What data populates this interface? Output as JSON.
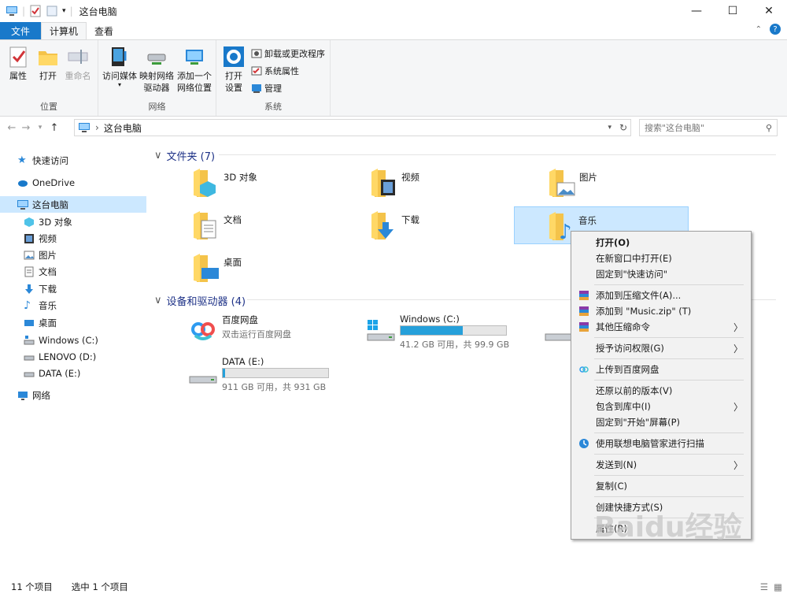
{
  "window": {
    "title": "这台电脑",
    "min": "—",
    "max": "☐",
    "close": "✕"
  },
  "tabs": {
    "file": "文件",
    "computer": "计算机",
    "view": "查看",
    "help": "?"
  },
  "ribbon": {
    "location": {
      "label": "位置",
      "properties": "属性",
      "open": "打开",
      "rename": "重命名"
    },
    "network": {
      "label": "网络",
      "media1": "访问媒体",
      "map1": "映射网络",
      "map2": "驱动器",
      "add1": "添加一个",
      "add2": "网络位置"
    },
    "system": {
      "label": "系统",
      "settings1": "打开",
      "settings2": "设置",
      "uninstall": "卸载或更改程序",
      "sysprops": "系统属性",
      "manage": "管理"
    }
  },
  "address": {
    "path": "这台电脑",
    "search_placeholder": "搜索\"这台电脑\""
  },
  "sidebar": {
    "quick": "快速访问",
    "onedrive": "OneDrive",
    "thispc": "这台电脑",
    "items": [
      "3D 对象",
      "视频",
      "图片",
      "文档",
      "下载",
      "音乐",
      "桌面",
      "Windows (C:)",
      "LENOVO (D:)",
      "DATA (E:)"
    ],
    "network": "网络"
  },
  "folders": {
    "header": "文件夹 (7)",
    "items": [
      "3D 对象",
      "视频",
      "图片",
      "文档",
      "下载",
      "音乐",
      "桌面"
    ]
  },
  "drives": {
    "header": "设备和驱动器 (4)",
    "baidu": {
      "name": "百度网盘",
      "sub": "双击运行百度网盘"
    },
    "c": {
      "name": "Windows (C:)",
      "sub": "41.2 GB 可用，共 99.9 GB",
      "used": 0.59
    },
    "e": {
      "name": "DATA (E:)",
      "sub": "911 GB 可用，共 931 GB",
      "used": 0.02
    }
  },
  "context_menu": {
    "open": "打开(O)",
    "open_new": "在新窗口中打开(E)",
    "pin_quick": "固定到\"快速访问\"",
    "add_archive": "添加到压缩文件(A)...",
    "add_zip": "添加到 \"Music.zip\" (T)",
    "other_compress": "其他压缩命令",
    "grant": "授予访问权限(G)",
    "upload_baidu": "上传到百度网盘",
    "restore": "还原以前的版本(V)",
    "include_lib": "包含到库中(I)",
    "pin_start": "固定到\"开始\"屏幕(P)",
    "scan": "使用联想电脑管家进行扫描",
    "sendto": "发送到(N)",
    "copy": "复制(C)",
    "shortcut": "创建快捷方式(S)",
    "properties": "属性(R)"
  },
  "status": {
    "count": "11 个项目",
    "selected": "选中 1 个项目"
  },
  "watermark": "Baidu经验"
}
